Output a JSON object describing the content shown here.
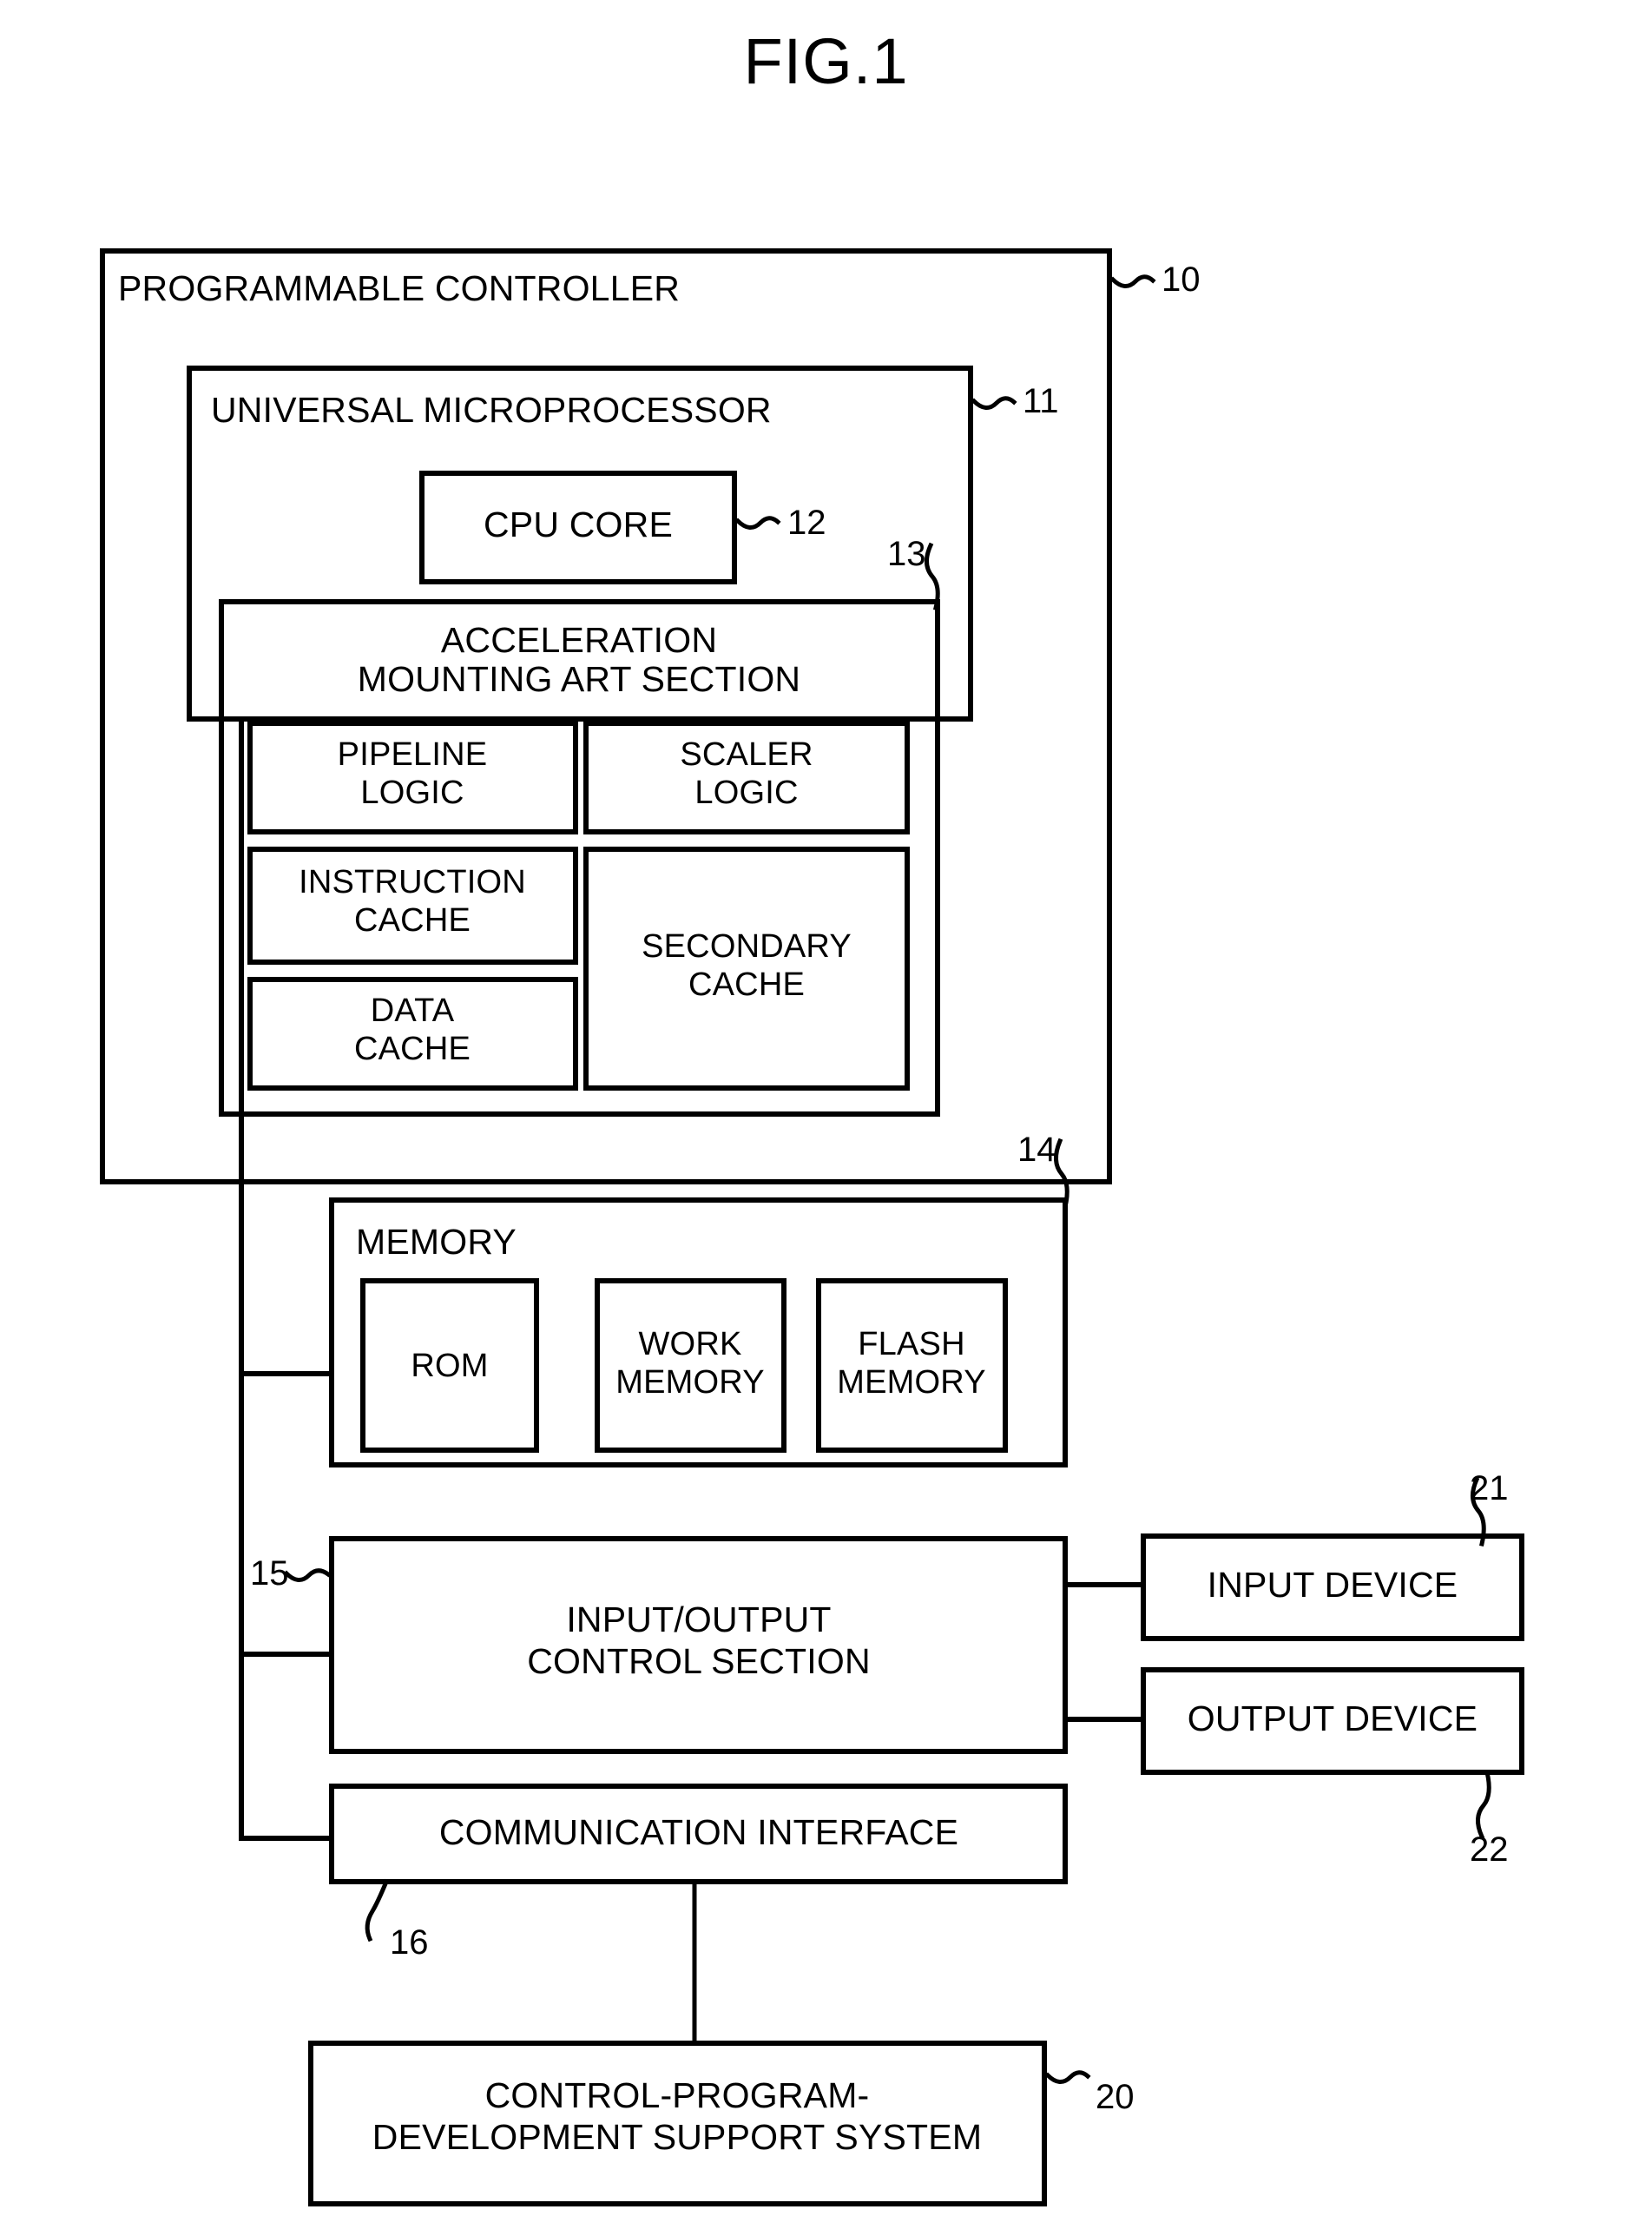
{
  "figure": {
    "title": "FIG.1"
  },
  "blocks": {
    "programmable_controller": {
      "label": "PROGRAMMABLE CONTROLLER",
      "ref": "10"
    },
    "universal_microprocessor": {
      "label": "UNIVERSAL MICROPROCESSOR",
      "ref": "11"
    },
    "cpu_core": {
      "label": "CPU CORE",
      "ref": "12"
    },
    "acceleration_section": {
      "label_line1": "ACCELERATION",
      "label_line2": "MOUNTING ART SECTION",
      "ref": "13"
    },
    "pipeline_logic": {
      "label_line1": "PIPELINE",
      "label_line2": "LOGIC"
    },
    "scaler_logic": {
      "label_line1": "SCALER",
      "label_line2": "LOGIC"
    },
    "instruction_cache": {
      "label_line1": "INSTRUCTION",
      "label_line2": "CACHE"
    },
    "data_cache": {
      "label_line1": "DATA",
      "label_line2": "CACHE"
    },
    "secondary_cache": {
      "label_line1": "SECONDARY",
      "label_line2": "CACHE"
    },
    "memory": {
      "label": "MEMORY",
      "ref": "14"
    },
    "rom": {
      "label": "ROM"
    },
    "work_memory": {
      "label_line1": "WORK",
      "label_line2": "MEMORY"
    },
    "flash_memory": {
      "label_line1": "FLASH",
      "label_line2": "MEMORY"
    },
    "io_control_section": {
      "label_line1": "INPUT/OUTPUT",
      "label_line2": "CONTROL SECTION",
      "ref": "15"
    },
    "communication_interface": {
      "label": "COMMUNICATION INTERFACE",
      "ref": "16"
    },
    "input_device": {
      "label": "INPUT DEVICE",
      "ref": "21"
    },
    "output_device": {
      "label": "OUTPUT DEVICE",
      "ref": "22"
    },
    "support_system": {
      "label_line1": "CONTROL-PROGRAM-",
      "label_line2": "DEVELOPMENT SUPPORT SYSTEM",
      "ref": "20"
    }
  },
  "style": {
    "line_color": "#000000",
    "background": "#ffffff"
  }
}
